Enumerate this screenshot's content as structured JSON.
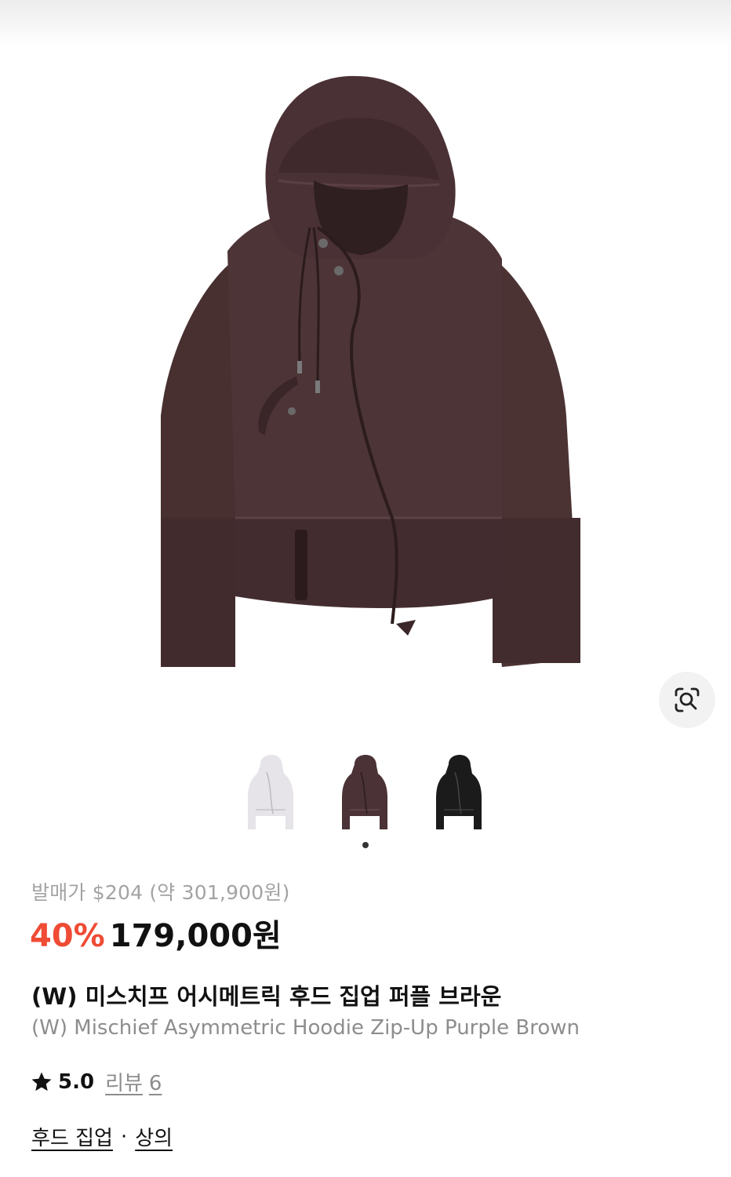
{
  "product": {
    "original_price_label": "발매가 $204 (약 301,900원)",
    "discount": "40%",
    "sale_price": "179,000원",
    "title_ko": "(W) 미스치프 어시메트릭 후드 집업 퍼플 브라운",
    "title_en": "(W) Mischief Asymmetric Hoodie Zip-Up Purple Brown"
  },
  "rating": {
    "score": "5.0",
    "review_label": "리뷰",
    "review_count": "6"
  },
  "categories": {
    "primary": "후드 집업",
    "separator": "·",
    "secondary": "상의"
  },
  "colors": {
    "discount": "#ef4b35",
    "hoodie_brown": "#4a3236",
    "hoodie_light": "#e9e7ea",
    "hoodie_black": "#1b1b1b"
  },
  "gallery": {
    "icons": [
      "lens-search-icon"
    ],
    "variants": [
      "light-gray",
      "purple-brown",
      "black"
    ],
    "selected_variant": "purple-brown"
  }
}
